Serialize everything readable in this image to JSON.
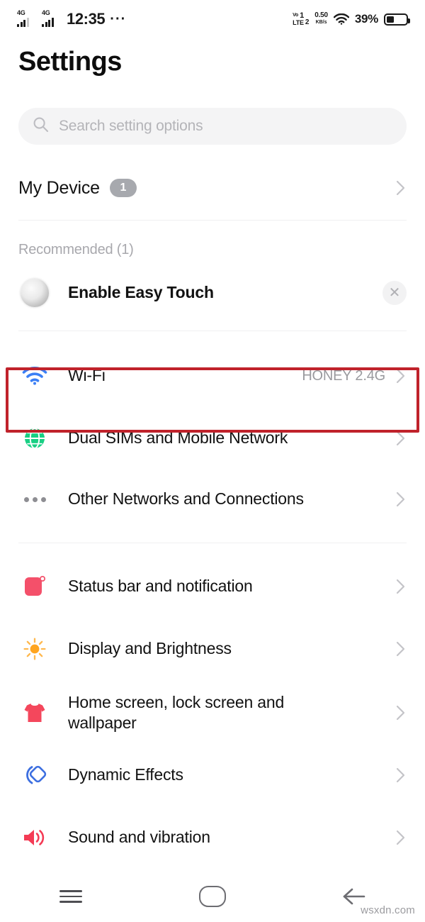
{
  "status_bar": {
    "sim1_network": "4G",
    "sim2_network": "4G",
    "time": "12:35",
    "overflow": "···",
    "volte_label": "VoLTE",
    "volte_sim1": "1",
    "volte_sim2": "2",
    "net_speed_value": "0.50",
    "net_speed_unit": "KB/s",
    "wifi_icon": "wifi-icon",
    "battery_percent": "39%",
    "battery_level": 39
  },
  "header": {
    "title": "Settings"
  },
  "search": {
    "icon": "search-icon",
    "placeholder": "Search setting options",
    "value": ""
  },
  "device_row": {
    "label": "My Device",
    "badge": "1",
    "chevron": "chevron-right-icon"
  },
  "recommended": {
    "section_title": "Recommended (1)",
    "item_label": "Enable Easy Touch",
    "item_icon": "easy-touch-ball-icon",
    "dismiss_icon": "close-icon"
  },
  "highlight": {
    "color": "#c0222b",
    "target": "wifi-row"
  },
  "groups": [
    {
      "rows": [
        {
          "label": "Wi-Fi",
          "value": "HONEY 2.4G",
          "icon": "wifi-icon",
          "icon_color": "#3b7ff5",
          "highlighted": true
        },
        {
          "label": "Dual SIMs and Mobile Network",
          "value": "",
          "icon": "globe-icon",
          "icon_color": "#19cf84",
          "highlighted": false
        },
        {
          "label": "Other Networks and Connections",
          "value": "",
          "icon": "ellipsis-icon",
          "icon_color": "#8e8e93",
          "highlighted": false
        }
      ]
    },
    {
      "rows": [
        {
          "label": "Status bar and notification",
          "value": "",
          "icon": "notification-card-icon",
          "icon_color": "#f4506a",
          "highlighted": false
        },
        {
          "label": "Display and Brightness",
          "value": "",
          "icon": "sun-icon",
          "icon_color": "#ffa51f",
          "highlighted": false
        },
        {
          "label": "Home screen, lock screen and wallpaper",
          "value": "",
          "icon": "tshirt-icon",
          "icon_color": "#f4475c",
          "highlighted": false
        },
        {
          "label": "Dynamic Effects",
          "value": "",
          "icon": "dynamic-effects-icon",
          "icon_color": "#3d6fe0",
          "highlighted": false
        },
        {
          "label": "Sound and vibration",
          "value": "",
          "icon": "speaker-icon",
          "icon_color": "#f43b55",
          "highlighted": false
        }
      ]
    }
  ],
  "nav_bar": {
    "recents": "menu-icon",
    "home": "home-icon",
    "back": "back-arrow-icon"
  },
  "watermark": "wsxdn.com"
}
